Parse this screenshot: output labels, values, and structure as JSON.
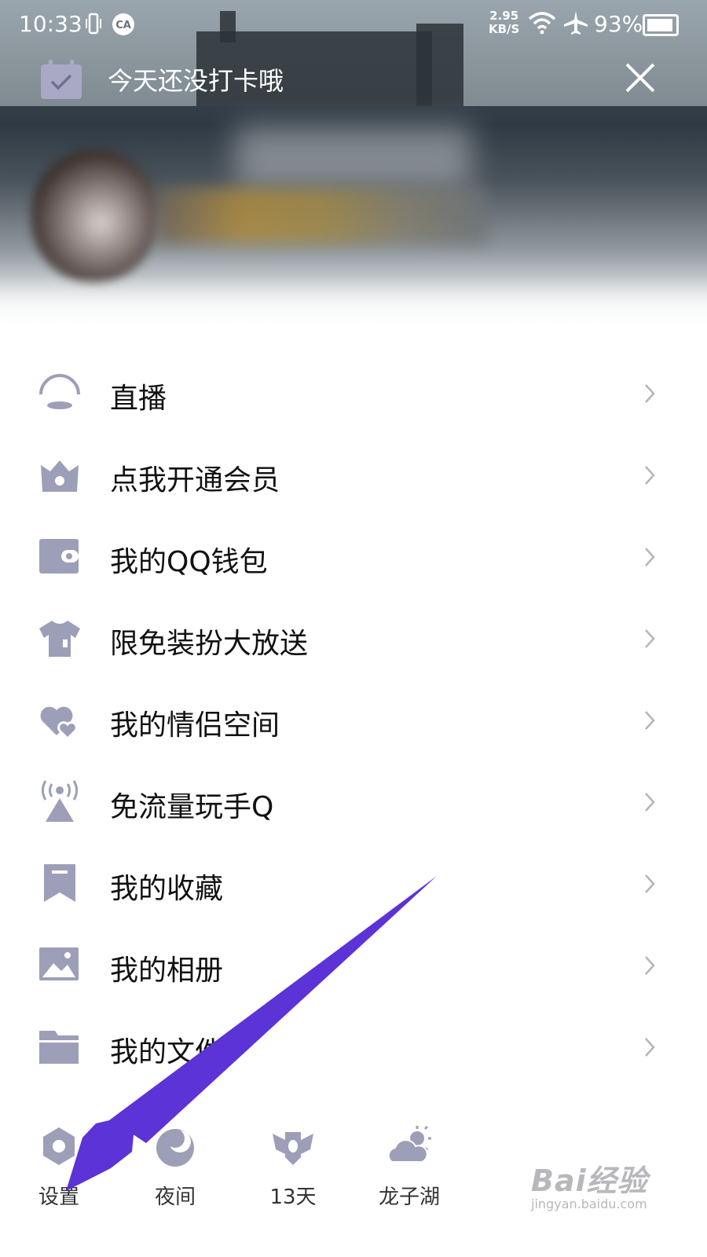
{
  "status_bar": {
    "time": "10:33",
    "net_speed_value": "2.95",
    "net_speed_unit": "KB/S",
    "battery_percent": "93%",
    "battery_level": 0.93
  },
  "checkin_banner": {
    "message": "今天还没打卡哦"
  },
  "menu": {
    "items": [
      {
        "label": "直播",
        "icon": "live-icon"
      },
      {
        "label": "点我开通会员",
        "icon": "crown-bag-icon"
      },
      {
        "label": "我的QQ钱包",
        "icon": "wallet-icon"
      },
      {
        "label": "限免装扮大放送",
        "icon": "tshirt-icon"
      },
      {
        "label": "我的情侣空间",
        "icon": "hearts-icon"
      },
      {
        "label": "免流量玩手Q",
        "icon": "signal-tower-icon"
      },
      {
        "label": "我的收藏",
        "icon": "bookmark-icon"
      },
      {
        "label": "我的相册",
        "icon": "photo-icon"
      },
      {
        "label": "我的文件",
        "icon": "folder-icon"
      }
    ]
  },
  "bottom_bar": {
    "settings_label": "设置",
    "night_label": "夜间",
    "days_label": "13天",
    "weather_label": "龙子湖"
  },
  "watermark": {
    "brand": "Bai经验",
    "url": "jingyan.baidu.com"
  },
  "colors": {
    "icon": "#9d9fb8",
    "text": "#111111",
    "chevron": "#b4b4bc",
    "arrow": "#5b33d6"
  }
}
